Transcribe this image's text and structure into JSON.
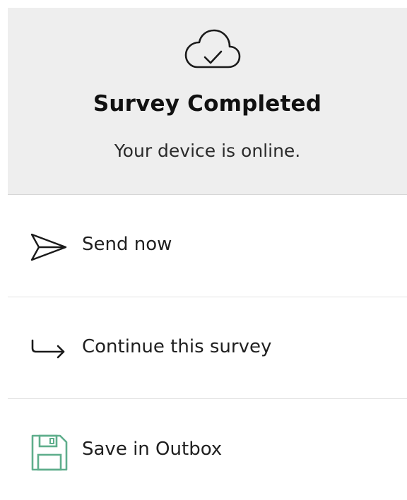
{
  "header": {
    "title": "Survey Completed",
    "status": "Your device is online.",
    "icon": "cloud-check-icon"
  },
  "actions": [
    {
      "label": "Send now",
      "icon": "paper-plane-icon"
    },
    {
      "label": "Continue this survey",
      "icon": "arrow-return-right-icon"
    },
    {
      "label": "Save in Outbox",
      "icon": "floppy-disk-icon"
    }
  ],
  "colors": {
    "header_background": "#eeeeee",
    "save_icon": "#5fae8c",
    "text": "#1f1f1f"
  }
}
